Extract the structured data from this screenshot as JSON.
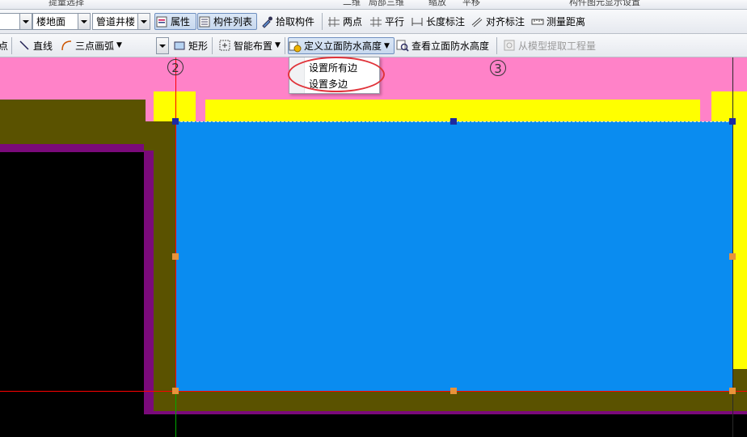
{
  "toolbar_top": {
    "items": [
      "",
      "提量选择",
      "",
      "",
      "",
      "",
      "二维",
      "局部三维",
      "",
      "缩放",
      "平移",
      "",
      "",
      "",
      "构件图元显示设置"
    ]
  },
  "toolbar1": {
    "floor_combo": "楼地面",
    "type_combo": "管道井楼",
    "attr_button": "属性",
    "component_list_button": "构件列表",
    "pick_button": "拾取构件",
    "two_point": "两点",
    "parallel": "平行",
    "length_dim": "长度标注",
    "align_dim": "对齐标注",
    "measure_dist": "测量距离"
  },
  "toolbar2": {
    "point_partial": "点",
    "line": "直线",
    "arc3": "三点画弧",
    "rect": "矩形",
    "smart_place": "智能布置",
    "define_height": "定义立面防水高度",
    "view_height": "查看立面防水高度",
    "extract_qty": "从模型提取工程量"
  },
  "dropdown": {
    "items": [
      "设置所有边",
      "设置多边"
    ]
  },
  "axes": {
    "a": "2",
    "b": "3"
  },
  "colors": {
    "pink": "#ff82c8",
    "yellow": "#ffff00",
    "olive": "#5a5200",
    "purple": "#7a0a7a",
    "blue": "#0a8cf0",
    "red_axis": "#ff0000",
    "callout": "#e0333a"
  }
}
